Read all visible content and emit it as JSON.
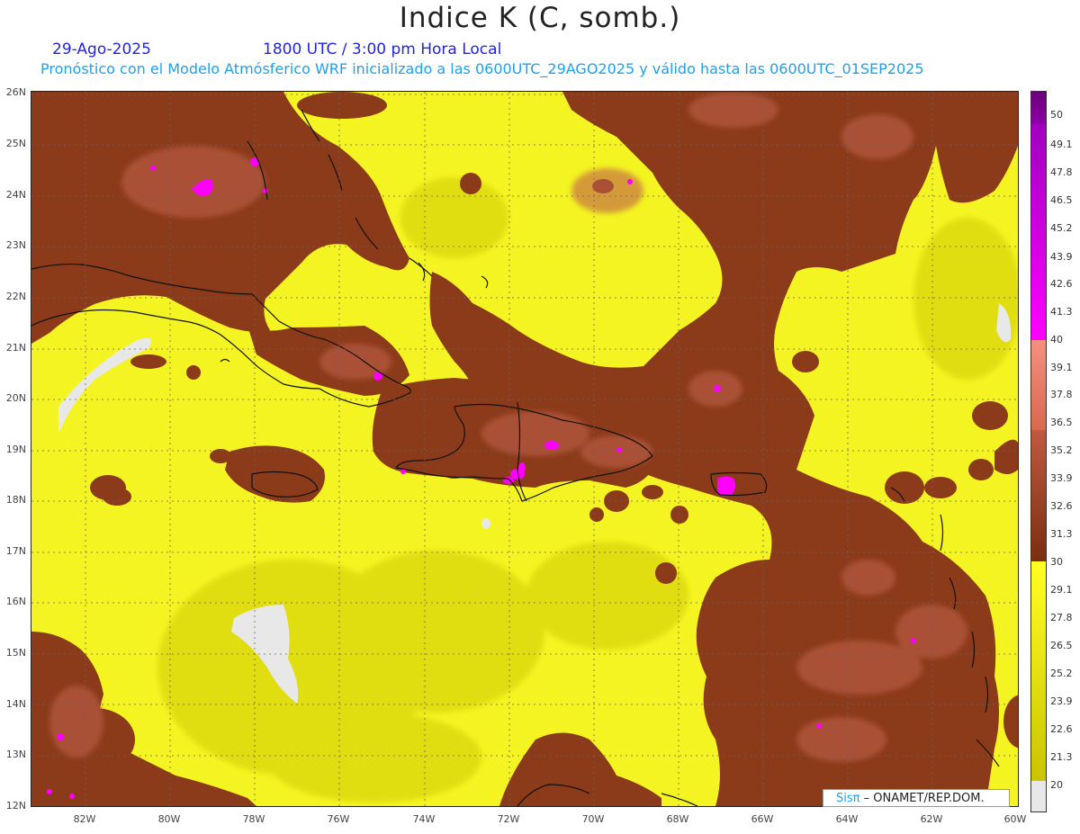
{
  "header": {
    "title": "Indice K (C, somb.)",
    "date": "29-Ago-2025",
    "time": "1800 UTC / 3:00 pm Hora Local",
    "subtitle": "Pronóstico con el Modelo Atmósferico WRF inicializado a las 0600UTC_29AGO2025 y válido hasta las  0600UTC_01SEP2025"
  },
  "map": {
    "lat_labels": [
      "26N",
      "25N",
      "24N",
      "23N",
      "22N",
      "21N",
      "20N",
      "19N",
      "18N",
      "17N",
      "16N",
      "15N",
      "14N",
      "13N",
      "12N"
    ],
    "lon_labels": [
      "82W",
      "80W",
      "78W",
      "76W",
      "74W",
      "72W",
      "70W",
      "68W",
      "66W",
      "64W",
      "62W",
      "60W"
    ],
    "extent": {
      "lon_min": -83.2,
      "lon_max": -60,
      "lat_min": 11.9,
      "lat_max": 26.1
    }
  },
  "colorbar": {
    "labels": [
      "50",
      "49.1",
      "47.8",
      "46.5",
      "45.2",
      "43.9",
      "42.6",
      "41.3",
      "40",
      "39.1",
      "37.8",
      "36.5",
      "35.2",
      "33.9",
      "32.6",
      "31.3",
      "30",
      "29.1",
      "27.8",
      "26.5",
      "25.2",
      "23.9",
      "22.6",
      "21.3",
      "20"
    ],
    "colors": {
      "purple": "#6a0077",
      "magenta": "#ff00ff",
      "pink": "#f08080",
      "brown": "#8b3a1a",
      "dark_brown": "#7a2e10",
      "yellow": "#ffff22",
      "olive": "#c8c400",
      "gray": "#e8e8e8"
    }
  },
  "credit": {
    "sis": "Sisπ",
    "org": "– ONAMET/REP.DOM."
  }
}
